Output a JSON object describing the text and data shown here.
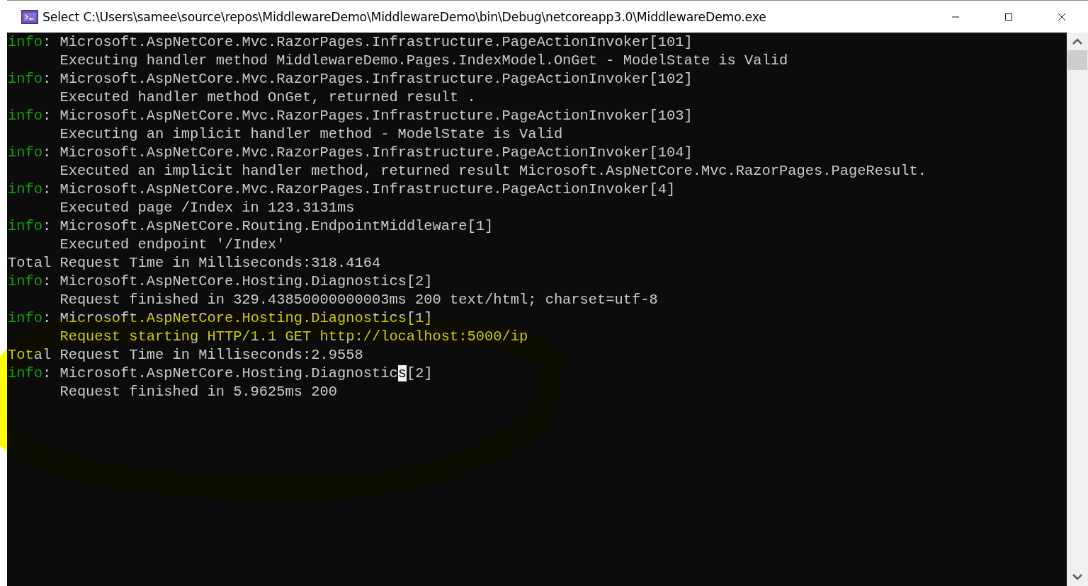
{
  "window": {
    "title": "Select C:\\Users\\samee\\source\\repos\\MiddlewareDemo\\MiddlewareDemo\\bin\\Debug\\netcoreapp3.0\\MiddlewareDemo.exe"
  },
  "console": {
    "lines": [
      {
        "kind": "info",
        "label": "info",
        "text": ": Microsoft.AspNetCore.Mvc.RazorPages.Infrastructure.PageActionInvoker[101]"
      },
      {
        "kind": "detail",
        "text": "Executing handler method MiddlewareDemo.Pages.IndexModel.OnGet - ModelState is Valid"
      },
      {
        "kind": "info",
        "label": "info",
        "text": ": Microsoft.AspNetCore.Mvc.RazorPages.Infrastructure.PageActionInvoker[102]"
      },
      {
        "kind": "detail",
        "text": "Executed handler method OnGet, returned result ."
      },
      {
        "kind": "info",
        "label": "info",
        "text": ": Microsoft.AspNetCore.Mvc.RazorPages.Infrastructure.PageActionInvoker[103]"
      },
      {
        "kind": "detail",
        "text": "Executing an implicit handler method - ModelState is Valid"
      },
      {
        "kind": "info",
        "label": "info",
        "text": ": Microsoft.AspNetCore.Mvc.RazorPages.Infrastructure.PageActionInvoker[104]"
      },
      {
        "kind": "detail",
        "text": "Executed an implicit handler method, returned result Microsoft.AspNetCore.Mvc.RazorPages.PageResult."
      },
      {
        "kind": "info",
        "label": "info",
        "text": ": Microsoft.AspNetCore.Mvc.RazorPages.Infrastructure.PageActionInvoker[4]"
      },
      {
        "kind": "detail",
        "text": "Executed page /Index in 123.3131ms"
      },
      {
        "kind": "info",
        "label": "info",
        "text": ": Microsoft.AspNetCore.Routing.EndpointMiddleware[1]"
      },
      {
        "kind": "detail",
        "text": "Executed endpoint '/Index'"
      },
      {
        "kind": "plain",
        "text": "Total Request Time in Milliseconds:318.4164"
      },
      {
        "kind": "info",
        "label": "info",
        "text": ": Microsoft.AspNetCore.Hosting.Diagnostics[2]"
      },
      {
        "kind": "detail",
        "text": "Request finished in 329.43850000000003ms 200 text/html; charset=utf-8"
      },
      {
        "kind": "info",
        "label": "info",
        "text": ": Microsoft.AspNetCore.Hosting.Diagnostics[1]"
      },
      {
        "kind": "detail",
        "text": "Request starting HTTP/1.1 GET http://localhost:5000/ip"
      },
      {
        "kind": "plain",
        "text": "Total Request Time in Milliseconds:2.9558"
      },
      {
        "kind": "info",
        "label": "info",
        "text": ": Microsoft.AspNetCore.Hosting.Diagnostic",
        "cursor": "s",
        "text_after": "[2]"
      },
      {
        "kind": "detail",
        "text": "Request finished in 5.9625ms 200"
      }
    ]
  }
}
